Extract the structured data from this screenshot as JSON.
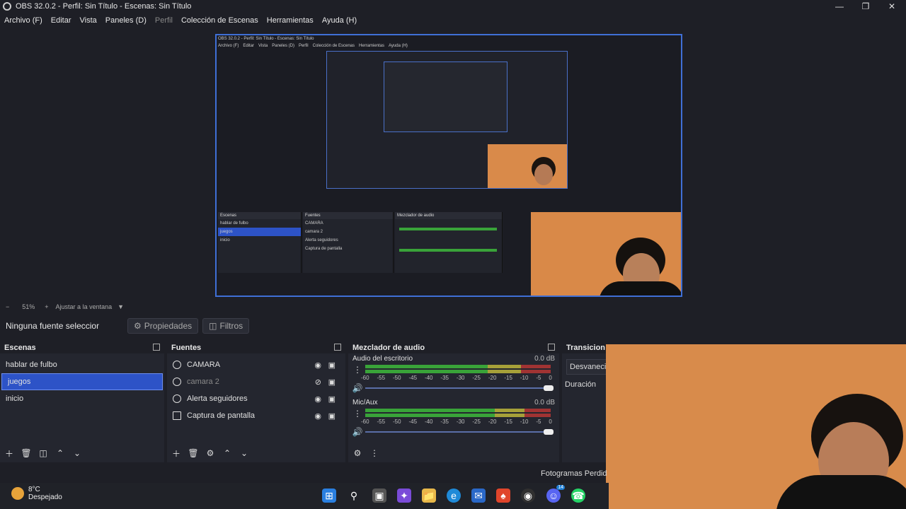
{
  "window": {
    "title": "OBS 32.0.2 - Perfil: Sin Título - Escenas: Sin Título"
  },
  "menu": [
    {
      "label": "Archivo (F)",
      "dim": false
    },
    {
      "label": "Editar",
      "dim": false
    },
    {
      "label": "Vista",
      "dim": false
    },
    {
      "label": "Paneles (D)",
      "dim": false
    },
    {
      "label": "Perfil",
      "dim": true
    },
    {
      "label": "Colección de Escenas",
      "dim": false
    },
    {
      "label": "Herramientas",
      "dim": false
    },
    {
      "label": "Ayuda (H)",
      "dim": false
    }
  ],
  "zoom": {
    "minus": "−",
    "value": "51%",
    "plus": "+",
    "fit_label": "Ajustar a la ventana"
  },
  "props_bar": {
    "no_selection": "Ninguna fuente seleccionada",
    "properties_label": "Propiedades",
    "filters_label": "Filtros"
  },
  "scenes": {
    "title": "Escenas",
    "items": [
      {
        "label": "hablar de fulbo",
        "selected": false
      },
      {
        "label": "juegos",
        "selected": true
      },
      {
        "label": "inicio",
        "selected": false
      }
    ]
  },
  "sources": {
    "title": "Fuentes",
    "items": [
      {
        "label": "CAMARA",
        "icon": "camera-icon",
        "visible": true
      },
      {
        "label": "camara 2",
        "icon": "camera-icon",
        "visible": false
      },
      {
        "label": "Alerta seguidores",
        "icon": "browser-icon",
        "visible": true
      },
      {
        "label": "Captura de pantalla",
        "icon": "monitor-icon",
        "visible": true
      }
    ]
  },
  "mixer": {
    "title": "Mezclador de audio",
    "channels": [
      {
        "name": "Audio del escritorio",
        "db": "0.0 dB",
        "level_green": 0.66,
        "level_yellow": 0.18,
        "level_red": 0.16
      },
      {
        "name": "Mic/Aux",
        "db": "0.0 dB",
        "level_green": 0.7,
        "level_yellow": 0.16,
        "level_red": 0.14
      }
    ],
    "scale": [
      "-60",
      "-55",
      "-50",
      "-45",
      "-40",
      "-35",
      "-30",
      "-25",
      "-20",
      "-15",
      "-10",
      "-5",
      "0"
    ]
  },
  "transitions": {
    "title": "Transicion",
    "fade": "Desvanecim",
    "duration_label": "Duración"
  },
  "status": {
    "frames_dropped": "Fotogramas Perdid"
  },
  "taskbar": {
    "temperature": "8°C",
    "weather": "Despejado",
    "discord_badge": "14"
  },
  "colors": {
    "accent": "#2d53c7",
    "background": "#1e1f26",
    "panel": "#24262f"
  }
}
